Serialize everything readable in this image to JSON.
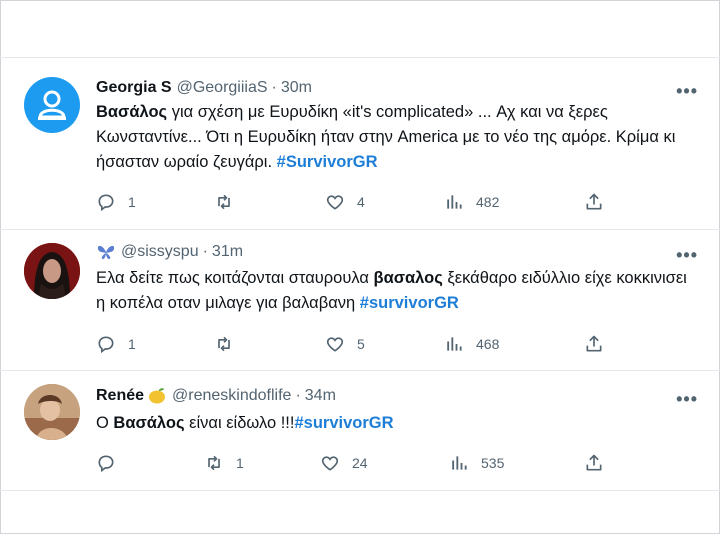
{
  "tweets": [
    {
      "name": "Georgia S",
      "handle": "@GeorgiiiaS",
      "dot": "·",
      "time": "30m",
      "more": "•••",
      "text": {
        "t1": "Βασάλος",
        "t2": " για σχέση με Ευρυδίκη «it's complicated» ... Αχ και να ξερες Κωνσταντίνε... Ότι η Ευρυδίκη ήταν στην America με το νέο της αμόρε. Κρίμα κι ήσασταν ωραίο ζευγάρι. ",
        "t3": "#SurvivorGR"
      },
      "reply_count": "1",
      "retweet_count": "",
      "like_count": "4",
      "view_count": "482"
    },
    {
      "name": "",
      "handle": "@sissyspu",
      "dot": "·",
      "time": "31m",
      "more": "•••",
      "text": {
        "t1": "Ελα δείτε πως κοιτάζονται σταυρουλα ",
        "t2": "βασαλος",
        "t3": " ξεκάθαρο ειδύλλιο είχε κοκκινισει η κοπέλα οταν μιλαγε για βαλαβανη ",
        "t4": "#survivorGR"
      },
      "reply_count": "1",
      "retweet_count": "",
      "like_count": "5",
      "view_count": "468"
    },
    {
      "name": "Renée",
      "handle": "@reneskindoflife",
      "dot": "·",
      "time": "34m",
      "more": "•••",
      "text": {
        "t1": "Ο ",
        "t2": "Βασάλος",
        "t3": " είναι είδωλο !!!",
        "t4": "#survivorGR"
      },
      "reply_count": "",
      "retweet_count": "1",
      "like_count": "24",
      "view_count": "535"
    }
  ],
  "colors": {
    "text": "#0f1419",
    "muted": "#536471",
    "hashtag": "#1d7ed8",
    "divider": "#e6e9ec",
    "avatar_blue": "#1d9bf0"
  },
  "icons": [
    "default-avatar-icon",
    "butterfly-emoji",
    "lemon-emoji",
    "reply-icon",
    "retweet-icon",
    "like-icon",
    "views-icon",
    "share-icon",
    "more-icon"
  ]
}
